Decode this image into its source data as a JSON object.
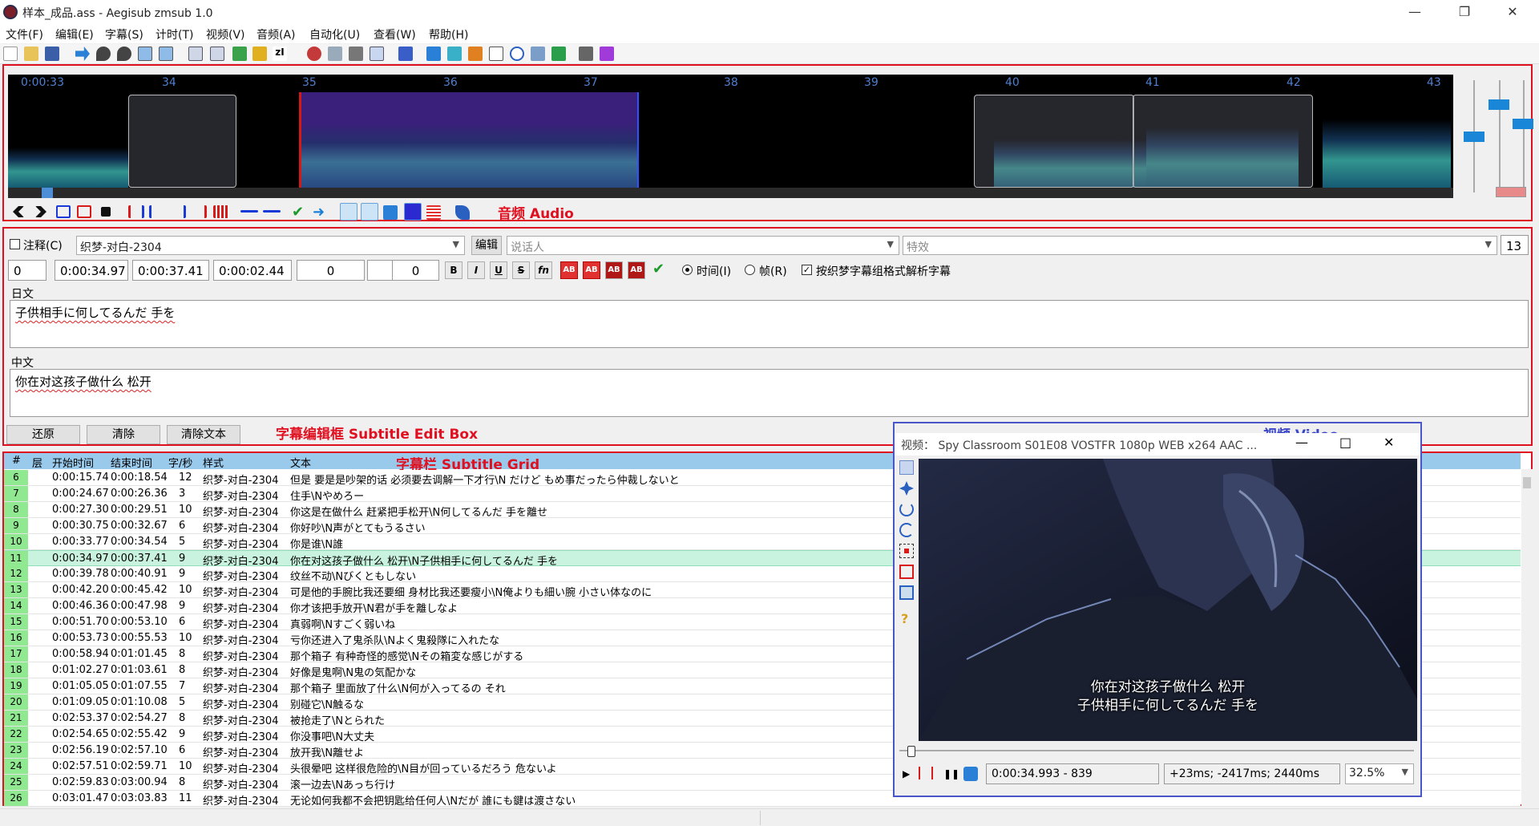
{
  "window": {
    "title": "样本_成品.ass - Aegisub zmsub 1.0",
    "minimize": "—",
    "maximize": "❐",
    "close": "✕"
  },
  "menu": [
    "文件(F)",
    "编辑(E)",
    "字幕(S)",
    "计时(T)",
    "视频(V)",
    "音频(A)",
    "自动化(U)",
    "查看(W)",
    "帮助(H)"
  ],
  "audio": {
    "label": "音频 Audio",
    "ruler": [
      "0:00:33",
      "34",
      "35",
      "36",
      "37",
      "38",
      "39",
      "40",
      "41",
      "42",
      "43"
    ]
  },
  "edit": {
    "label": "字幕编辑框 Subtitle Edit Box",
    "comment_label": "注释(C)",
    "style": "织梦-对白-2304",
    "edit_button": "编辑",
    "actor_placeholder": "说话人",
    "effect_placeholder": "特效",
    "margin_value": "13",
    "layer": "0",
    "start_time": "0:00:34.97",
    "end_time": "0:00:37.41",
    "duration": "0:00:02.44",
    "margin_l": "0",
    "margin_r": "0",
    "margin_v": "0",
    "fmt_buttons": [
      "B",
      "I",
      "U",
      "S",
      "fn",
      "AB",
      "AB",
      "AB",
      "AB"
    ],
    "radio_time": "时间(I)",
    "radio_frame": "帧(R)",
    "checkbox_parse": "按织梦字幕组格式解析字幕",
    "jp_label": "日文",
    "jp_text": "子供相手に何してるんだ 手を",
    "cn_label": "中文",
    "cn_text": "你在对这孩子做什么 松开",
    "btn_restore": "还原",
    "btn_clear": "清除",
    "btn_clear_text": "清除文本"
  },
  "grid": {
    "label": "字幕栏 Subtitle Grid",
    "headers": [
      "#",
      "层",
      "开始时间",
      "结束时间",
      "字/秒",
      "样式",
      "文本"
    ],
    "rows": [
      {
        "n": "6",
        "start": "0:00:15.74",
        "end": "0:00:18.54",
        "cps": "12",
        "style": "织梦-对白-2304",
        "text": "但是 要是是吵架的话 必须要去调解一下才行\\N だけど もめ事だったら仲裁しないと"
      },
      {
        "n": "7",
        "start": "0:00:24.67",
        "end": "0:00:26.36",
        "cps": "3",
        "style": "织梦-对白-2304",
        "text": "住手\\Nやめろー"
      },
      {
        "n": "8",
        "start": "0:00:27.30",
        "end": "0:00:29.51",
        "cps": "10",
        "style": "织梦-对白-2304",
        "text": "你这是在做什么 赶紧把手松开\\N何してるんだ 手を離せ"
      },
      {
        "n": "9",
        "start": "0:00:30.75",
        "end": "0:00:32.67",
        "cps": "6",
        "style": "织梦-对白-2304",
        "text": "你好吵\\N声がとてもうるさい"
      },
      {
        "n": "10",
        "start": "0:00:33.77",
        "end": "0:00:34.54",
        "cps": "5",
        "style": "织梦-对白-2304",
        "text": "你是谁\\N誰"
      },
      {
        "n": "11",
        "start": "0:00:34.97",
        "end": "0:00:37.41",
        "cps": "9",
        "style": "织梦-对白-2304",
        "text": "你在对这孩子做什么 松开\\N子供相手に何してるんだ 手を"
      },
      {
        "n": "12",
        "start": "0:00:39.78",
        "end": "0:00:40.91",
        "cps": "9",
        "style": "织梦-对白-2304",
        "text": "纹丝不动\\Nびくともしない"
      },
      {
        "n": "13",
        "start": "0:00:42.20",
        "end": "0:00:45.42",
        "cps": "10",
        "style": "织梦-对白-2304",
        "text": "可是他的手腕比我还要细 身材比我还要瘦小\\N俺よりも細い腕 小さい体なのに"
      },
      {
        "n": "14",
        "start": "0:00:46.36",
        "end": "0:00:47.98",
        "cps": "9",
        "style": "织梦-对白-2304",
        "text": "你才该把手放开\\N君が手を離しなよ"
      },
      {
        "n": "15",
        "start": "0:00:51.70",
        "end": "0:00:53.10",
        "cps": "6",
        "style": "织梦-对白-2304",
        "text": "真弱啊\\Nすごく弱いね"
      },
      {
        "n": "16",
        "start": "0:00:53.73",
        "end": "0:00:55.53",
        "cps": "10",
        "style": "织梦-对白-2304",
        "text": "亏你还进入了鬼杀队\\Nよく鬼殺隊に入れたな"
      },
      {
        "n": "17",
        "start": "0:00:58.94",
        "end": "0:01:01.45",
        "cps": "8",
        "style": "织梦-对白-2304",
        "text": "那个箱子 有种奇怪的感觉\\Nその箱変な感じがする"
      },
      {
        "n": "18",
        "start": "0:01:02.27",
        "end": "0:01:03.61",
        "cps": "8",
        "style": "织梦-对白-2304",
        "text": "好像是鬼啊\\N鬼の気配かな"
      },
      {
        "n": "19",
        "start": "0:01:05.05",
        "end": "0:01:07.55",
        "cps": "7",
        "style": "织梦-对白-2304",
        "text": "那个箱子 里面放了什么\\N何が入ってるの それ"
      },
      {
        "n": "20",
        "start": "0:01:09.05",
        "end": "0:01:10.08",
        "cps": "5",
        "style": "织梦-对白-2304",
        "text": "别碰它\\N触るな"
      },
      {
        "n": "21",
        "start": "0:02:53.37",
        "end": "0:02:54.27",
        "cps": "8",
        "style": "织梦-对白-2304",
        "text": "被抢走了\\Nとられた"
      },
      {
        "n": "22",
        "start": "0:02:54.65",
        "end": "0:02:55.42",
        "cps": "9",
        "style": "织梦-对白-2304",
        "text": "你没事吧\\N大丈夫"
      },
      {
        "n": "23",
        "start": "0:02:56.19",
        "end": "0:02:57.10",
        "cps": "6",
        "style": "织梦-对白-2304",
        "text": "放开我\\N離せよ"
      },
      {
        "n": "24",
        "start": "0:02:57.51",
        "end": "0:02:59.71",
        "cps": "10",
        "style": "织梦-对白-2304",
        "text": "头很晕吧 这样很危险的\\N目が回っているだろう 危ないよ"
      },
      {
        "n": "25",
        "start": "0:02:59.83",
        "end": "0:03:00.94",
        "cps": "8",
        "style": "织梦-对白-2304",
        "text": "滚一边去\\Nあっち行け"
      },
      {
        "n": "26",
        "start": "0:03:01.47",
        "end": "0:03:03.83",
        "cps": "11",
        "style": "织梦-对白-2304",
        "text": "无论如何我都不会把钥匙给任何人\\Nだが 誰にも鍵は渡さない"
      }
    ]
  },
  "video": {
    "label": "视频 Video",
    "title": "视频：  Spy Classroom S01E08 VOSTFR 1080p WEB x264 AAC ...",
    "sub_line1": "你在对这孩子做什么 松开",
    "sub_line2": "子供相手に何してるんだ 手を",
    "time_frame": "0:00:34.993 - 839",
    "offsets": "+23ms; -2417ms; 2440ms",
    "zoom": "32.5%"
  },
  "colors": {
    "annotation_red": "#e01020",
    "annotation_blue": "#3a46c8",
    "selection_purple": "#3a207a"
  }
}
